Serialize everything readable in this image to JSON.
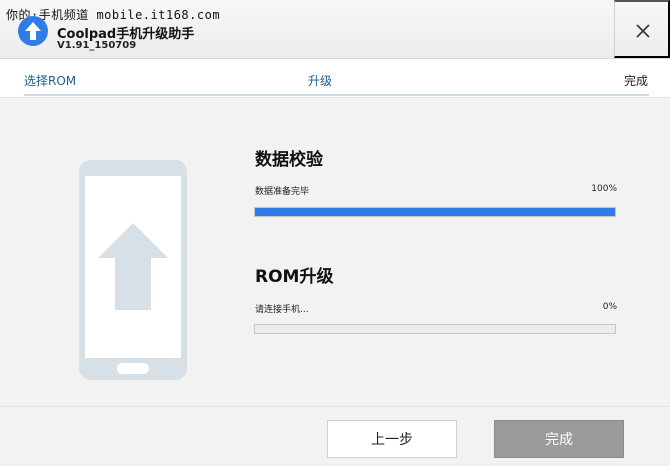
{
  "watermark": "你的·手机频道 mobile.it168.com",
  "app": {
    "name": "Coolpad手机升级助手",
    "version": "V1.91_150709",
    "accent_color": "#2f7be7"
  },
  "steps": [
    {
      "label": "选择ROM"
    },
    {
      "label": "升级"
    },
    {
      "label": "完成"
    }
  ],
  "verify": {
    "title": "数据校验",
    "status": "数据准备完毕",
    "percent_label": "100%",
    "progress": 1.0
  },
  "upgrade": {
    "title": "ROM升级",
    "status": "请连接手机...",
    "percent_label": "0%",
    "progress": 0.0
  },
  "footer": {
    "prev_label": "上一步",
    "finish_label": "完成"
  },
  "icons": {
    "close": "close-icon",
    "logo": "upload-arrow-icon",
    "phone": "phone-upgrade-icon"
  }
}
